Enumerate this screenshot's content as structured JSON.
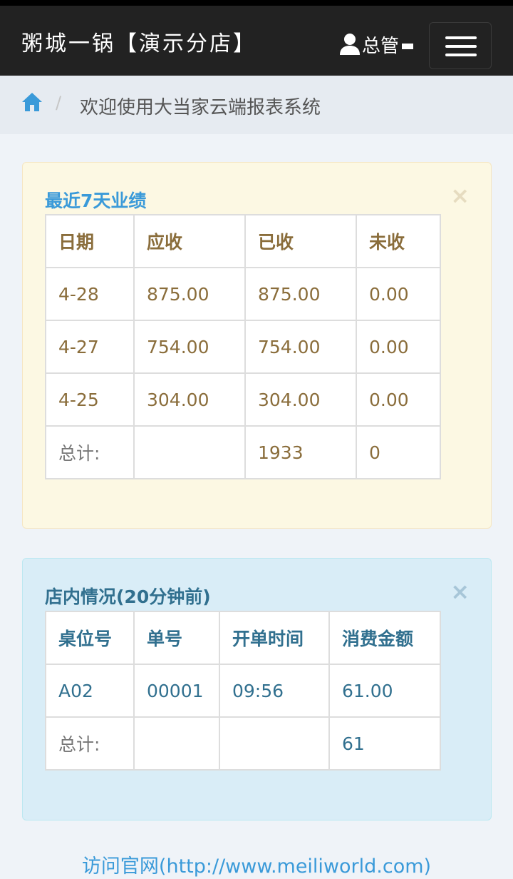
{
  "header": {
    "brand": "粥城一锅【演示分店】",
    "user_name": "总管"
  },
  "breadcrumb": {
    "text": "欢迎使用大当家云端报表系统",
    "separator": "/"
  },
  "sales_panel": {
    "title": "最近7天业绩",
    "close": "×",
    "columns": [
      "日期",
      "应收",
      "已收",
      "未收"
    ],
    "rows": [
      [
        "4-28",
        "875.00",
        "875.00",
        "0.00"
      ],
      [
        "4-27",
        "754.00",
        "754.00",
        "0.00"
      ],
      [
        "4-25",
        "304.00",
        "304.00",
        "0.00"
      ]
    ],
    "total": [
      "总计:",
      "",
      "1933",
      "0"
    ]
  },
  "store_panel": {
    "title": "店内情况(20分钟前)",
    "close": "×",
    "columns": [
      "桌位号",
      "单号",
      "开单时间",
      "消费金额"
    ],
    "rows": [
      [
        "A02",
        "00001",
        "09:56",
        "61.00"
      ]
    ],
    "total": [
      "总计:",
      "",
      "",
      "61"
    ]
  },
  "footer": {
    "link_text": "访问官网(http://www.meiliworld.com)"
  }
}
